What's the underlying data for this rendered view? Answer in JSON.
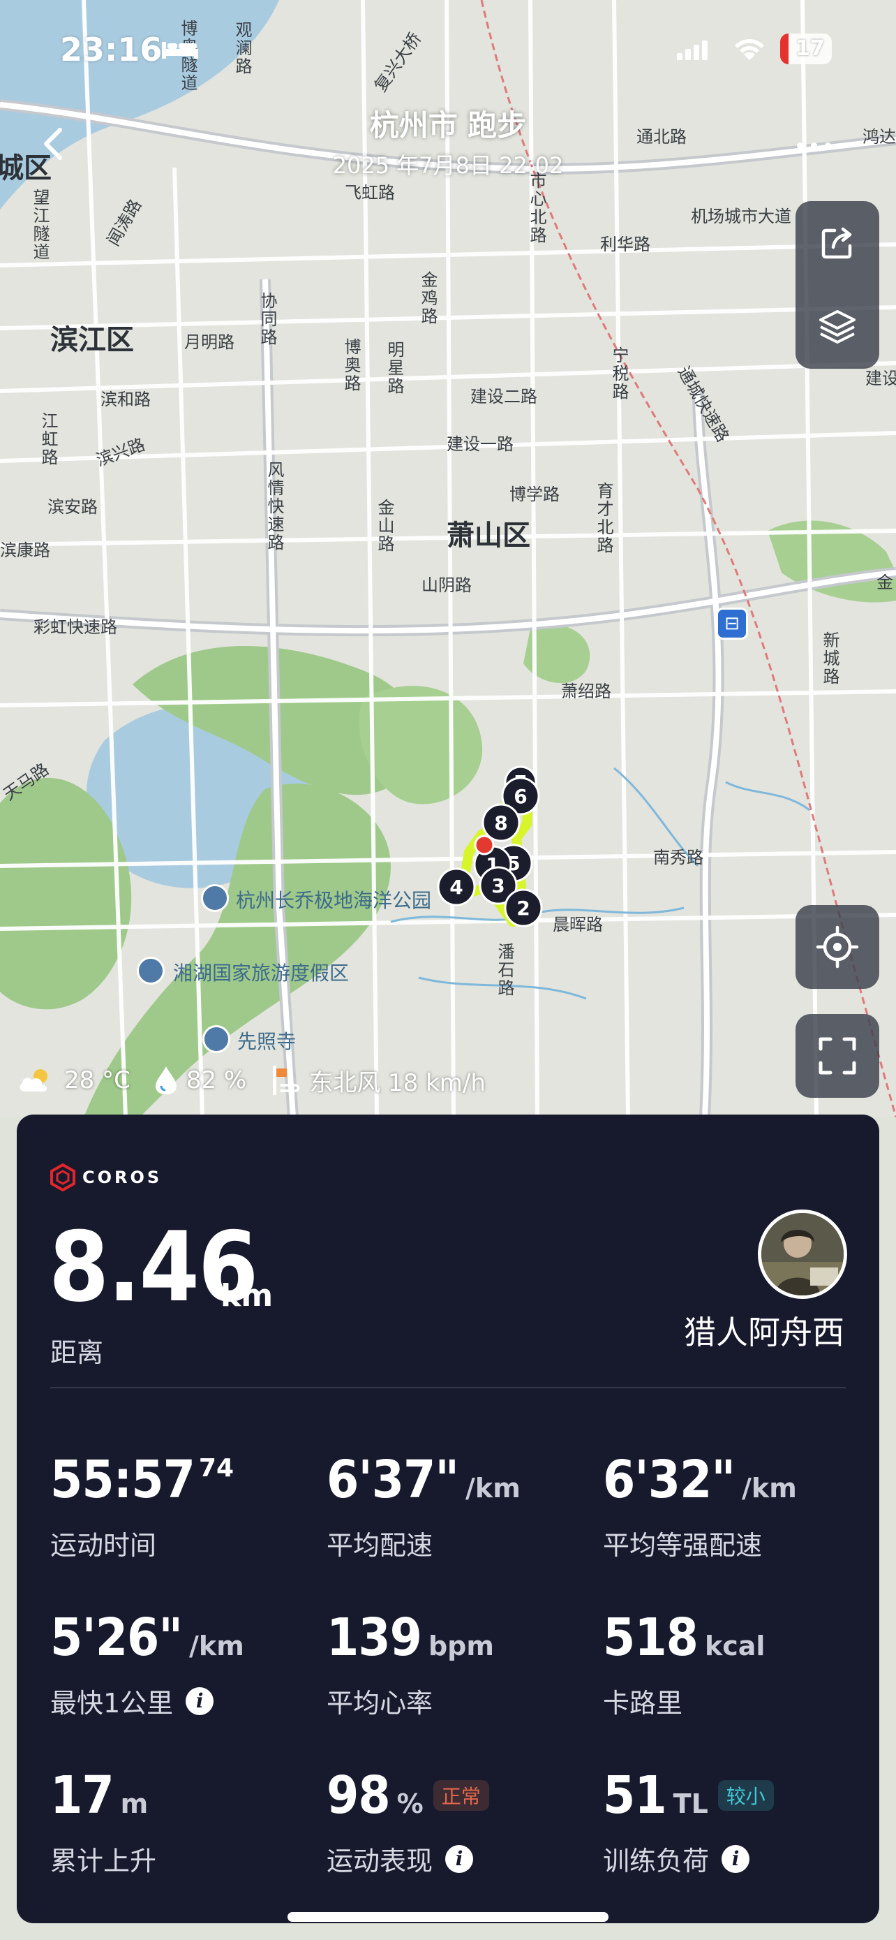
{
  "status_bar": {
    "time": "23:16",
    "battery": "17",
    "battery_color": "#e6322f"
  },
  "header": {
    "title": "杭州市 跑步",
    "date": "2025 年7月8日 22:02"
  },
  "map": {
    "districts": [
      "城区",
      "滨江区",
      "萧山区"
    ],
    "roads": [
      "博奥隧道",
      "观澜路",
      "复兴大桥",
      "望江隧道",
      "闻涛路",
      "飞虹路",
      "市心北路",
      "通北路",
      "机场城市大道",
      "利华路",
      "金鸡路",
      "协同路",
      "月明路",
      "博奥路",
      "明星路",
      "建设二路",
      "宁税路",
      "通城快速路",
      "滨和路",
      "江虹路",
      "滨兴路",
      "建设一路",
      "风情快速路",
      "博学路",
      "育才北路",
      "滨安路",
      "滨康路",
      "金山路",
      "山阴路",
      "彩虹快速路",
      "萧绍路",
      "新城路",
      "天马路",
      "南秀路",
      "晨晖路",
      "潘石路",
      "鸿达",
      "建设",
      "金"
    ],
    "pois": [
      "杭州长乔极地海洋公园",
      "湘湖国家旅游度假区",
      "先照寺"
    ],
    "route_markers": [
      "7",
      "6",
      "8",
      "1",
      "5",
      "4",
      "3",
      "2"
    ],
    "route_color": "#d7f52a"
  },
  "weather": {
    "temp": "28 °C",
    "humidity": "82 %",
    "wind": "东北风 18 km/h"
  },
  "card": {
    "brand": "COROS",
    "brand_color": "#e5252c",
    "distance": {
      "value": "8.46",
      "unit": "km",
      "label": "距离"
    },
    "user": {
      "name": "猎人阿舟西"
    },
    "stats": [
      {
        "value": "55:57",
        "sup": "74",
        "unit": "",
        "label": "运动时间"
      },
      {
        "value": "6'37\"",
        "unit": "/km",
        "label": "平均配速"
      },
      {
        "value": "6'32\"",
        "unit": "/km",
        "label": "平均等强配速"
      },
      {
        "value": "5'26\"",
        "unit": "/km",
        "label": "最快1公里",
        "info": "i"
      },
      {
        "value": "139",
        "unit": "bpm",
        "label": "平均心率"
      },
      {
        "value": "518",
        "unit": "kcal",
        "label": "卡路里"
      },
      {
        "value": "17",
        "unit": "m",
        "label": "累计上升"
      },
      {
        "value": "98",
        "unit": "%",
        "label": "运动表现",
        "badge": "正常",
        "info": "i"
      },
      {
        "value": "51",
        "unit": "TL",
        "label": "训练负荷",
        "badge": "较小",
        "info": "i"
      }
    ]
  }
}
